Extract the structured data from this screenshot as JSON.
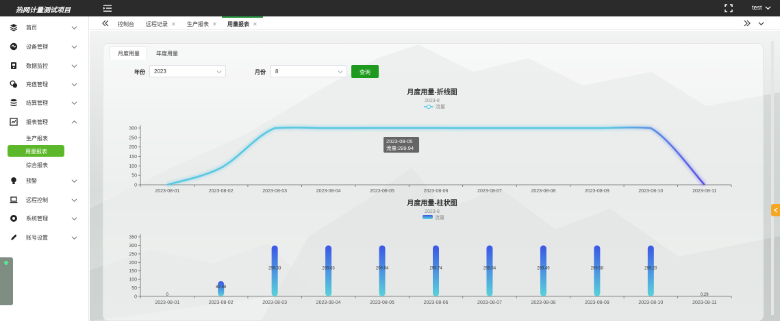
{
  "app": {
    "title": "热网计量测试项目",
    "user": "test"
  },
  "sidebar": {
    "items": [
      {
        "label": "首页",
        "icon": "layers-icon"
      },
      {
        "label": "设备管理",
        "icon": "device-icon"
      },
      {
        "label": "数据监控",
        "icon": "monitor-icon"
      },
      {
        "label": "充值管理",
        "icon": "recharge-icon"
      },
      {
        "label": "结算管理",
        "icon": "database-icon"
      },
      {
        "label": "报表管理",
        "icon": "report-icon"
      },
      {
        "label": "预警",
        "icon": "bulb-icon"
      },
      {
        "label": "远程控制",
        "icon": "laptop-icon"
      },
      {
        "label": "系统管理",
        "icon": "gear-icon"
      },
      {
        "label": "账号设置",
        "icon": "pen-icon"
      }
    ],
    "report_sub": [
      "生产报表",
      "用量报表",
      "综合报表"
    ]
  },
  "tabs": [
    {
      "label": "控制台",
      "closable": false
    },
    {
      "label": "远程记录",
      "closable": true
    },
    {
      "label": "生产报表",
      "closable": true
    },
    {
      "label": "用量报表",
      "closable": true
    }
  ],
  "card_tabs": [
    "月度用量",
    "年度用量"
  ],
  "form": {
    "year_label": "年份",
    "year_value": "2023",
    "month_label": "月份",
    "month_value": "8",
    "query_label": "查询"
  },
  "chart_data": [
    {
      "type": "line",
      "title": "月度用量-折线图",
      "subtitle": "2023-8",
      "legend": "流量",
      "x": [
        "2023-08-01",
        "2023-08-02",
        "2023-08-03",
        "2023-08-04",
        "2023-08-05",
        "2023-08-06",
        "2023-08-07",
        "2023-08-08",
        "2023-08-09",
        "2023-08-10",
        "2023-08-11"
      ],
      "values": [
        0,
        90,
        299,
        299.5,
        299.94,
        299.8,
        299.5,
        299.4,
        299.6,
        299.2,
        0.2
      ],
      "ylim": [
        0,
        300
      ],
      "yticks": [
        0,
        50,
        100,
        150,
        200,
        250,
        300
      ],
      "tooltip": {
        "date": "2023-08-05",
        "text": "流量:299.94"
      },
      "colors": [
        "#57c7e3",
        "#5b4ce8"
      ]
    },
    {
      "type": "bar",
      "title": "月度用量-柱状图",
      "subtitle": "2023-8",
      "legend": "流量",
      "x": [
        "2023-08-01",
        "2023-08-02",
        "2023-08-03",
        "2023-08-04",
        "2023-08-05",
        "2023-08-06",
        "2023-08-07",
        "2023-08-08",
        "2023-08-09",
        "2023-08-10",
        "2023-08-11"
      ],
      "values": [
        0,
        89.58,
        299.33,
        299.63,
        299.94,
        299.74,
        299.54,
        299.49,
        299.58,
        299.2,
        0.29
      ],
      "labels": [
        "0",
        "89.58",
        "299.33",
        "299.63",
        "299.94",
        "299.74",
        "299.54",
        "299.49",
        "299.58",
        "299.20",
        "0.29"
      ],
      "ylim": [
        0,
        350
      ],
      "yticks": [
        0,
        50,
        100,
        150,
        200,
        250,
        300,
        350
      ],
      "colors": [
        "#3b55e6",
        "#5ad2da"
      ]
    }
  ]
}
